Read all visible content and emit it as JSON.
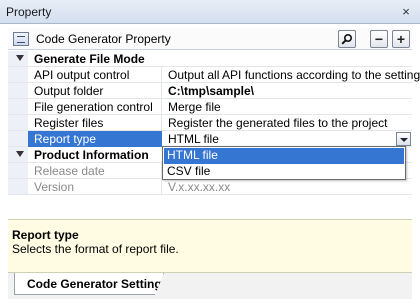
{
  "window": {
    "title": "Property",
    "close_glyph": "×"
  },
  "header": {
    "icon": "config-file-icon",
    "title": "Code Generator Property",
    "search_icon": "search-icon",
    "minus_label": "−",
    "plus_label": "+"
  },
  "categories": {
    "generate": {
      "label": "Generate File Mode",
      "expanded": true
    },
    "product": {
      "label": "Product Information",
      "expanded": true
    }
  },
  "rows": {
    "api": {
      "name": "API output control",
      "value": "Output all API functions according to the setting"
    },
    "folder": {
      "name": "Output folder",
      "value": "C:\\tmp\\sample\\"
    },
    "filegen": {
      "name": "File generation control",
      "value": "Merge file"
    },
    "register": {
      "name": "Register files",
      "value": "Register the generated files to the project"
    },
    "report": {
      "name": "Report type",
      "value": "HTML file"
    },
    "release": {
      "name": "Release date",
      "value": ""
    },
    "version": {
      "name": "Version",
      "value": "V.x.xx.xx.xx"
    }
  },
  "dropdown": {
    "options": [
      "HTML file",
      "CSV file"
    ],
    "selected": "HTML file"
  },
  "description": {
    "title": "Report type",
    "text": "Selects the format of report file."
  },
  "tabs": {
    "active": "Code Generator Setting"
  },
  "colors": {
    "selection": "#3476d1",
    "description_bg": "#fffce3"
  }
}
